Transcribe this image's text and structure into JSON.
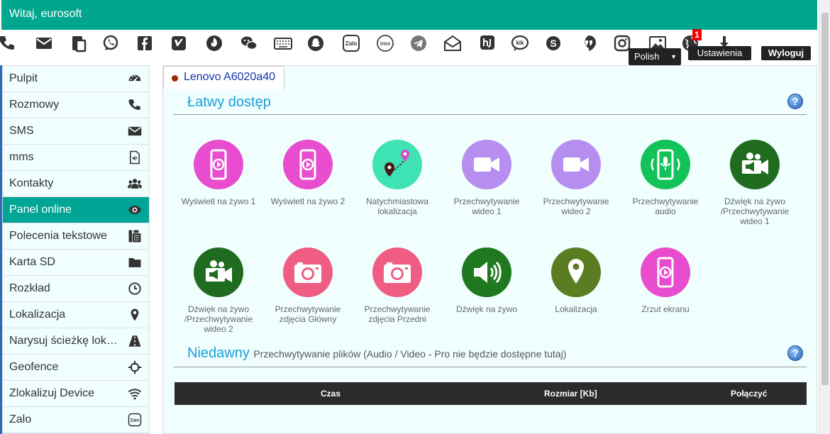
{
  "header": {
    "greeting": "Witaj, eurosoft"
  },
  "toolbar": {
    "icons": [
      "phone-icon",
      "mail-icon",
      "clipboard-icon",
      "whatsapp-icon",
      "facebook-icon",
      "viber-icon",
      "tinder-icon",
      "wechat-icon",
      "keyboard-icon",
      "snapchat-icon",
      "zalo-icon",
      "imo-icon",
      "telegram-icon",
      "email-open-icon",
      "hike-icon",
      "kik-icon",
      "skype-icon",
      "hangouts-icon",
      "instagram-icon",
      "photo-icon",
      "globe-icon",
      "download-icon"
    ],
    "badge": "1",
    "language": "Polish",
    "settings": "Ustawienia",
    "logout": "Wyloguj"
  },
  "sidebar": {
    "items": [
      {
        "label": "Pulpit",
        "icon": "dashboard-icon"
      },
      {
        "label": "Rozmowy",
        "icon": "phone-icon"
      },
      {
        "label": "SMS",
        "icon": "envelope-icon"
      },
      {
        "label": "mms",
        "icon": "audio-file-icon"
      },
      {
        "label": "Kontakty",
        "icon": "users-icon"
      },
      {
        "label": "Panel online",
        "icon": "eye-icon"
      },
      {
        "label": "Polecenia tekstowe",
        "icon": "fax-icon"
      },
      {
        "label": "Karta SD",
        "icon": "folder-icon"
      },
      {
        "label": "Rozkład",
        "icon": "clock-icon"
      },
      {
        "label": "Lokalizacja",
        "icon": "map-marker-icon"
      },
      {
        "label": "Narysuj ścieżkę lok…",
        "icon": "road-icon"
      },
      {
        "label": "Geofence",
        "icon": "crosshairs-icon"
      },
      {
        "label": "Zlokalizuj Device",
        "icon": "wifi-icon"
      },
      {
        "label": "Zalo",
        "icon": "zalo-icon"
      }
    ],
    "active_index": 5
  },
  "main": {
    "tab": "Lenovo A6020a40",
    "easy_access_title": "Łatwy dostęp",
    "recent_title": "Niedawny",
    "recent_sub": "Przechwytywanie plików (Audio / Video - Pro nie będzie dostępne tutaj)",
    "features": [
      {
        "label": "Wyświetl na żywo 1",
        "icon": "phone-play-icon",
        "color": "#e84ccf"
      },
      {
        "label": "Wyświetl na żywo 2",
        "icon": "phone-play-icon",
        "color": "#e84ccf"
      },
      {
        "label": "Natychmiastowa lokalizacja",
        "icon": "map-path-icon",
        "color": "#3fe3b3"
      },
      {
        "label": "Przechwytywanie wideo 1",
        "icon": "video-camera-icon",
        "color": "#b58ef0"
      },
      {
        "label": "Przechwytywanie wideo 2",
        "icon": "video-camera-icon",
        "color": "#b58ef0"
      },
      {
        "label": "Przechwytywanie audio",
        "icon": "phone-mic-icon",
        "color": "#14c25a"
      },
      {
        "label": "Dźwięk na żywo /Przechwytywanie wideo 1",
        "icon": "megaphone-camera-icon",
        "color": "#1f6b1f"
      },
      {
        "label": "Dźwięk na żywo /Przechwytywanie wideo 2",
        "icon": "megaphone-camera-icon",
        "color": "#1f6b1f"
      },
      {
        "label": "Przechwytywanie zdjęcia Główny",
        "icon": "camera-icon",
        "color": "#ef5d82"
      },
      {
        "label": "Przechwytywanie zdjęcia Przedni",
        "icon": "camera-icon",
        "color": "#ef5d82"
      },
      {
        "label": "Dźwięk na żywo",
        "icon": "speaker-icon",
        "color": "#1f7a1f"
      },
      {
        "label": "Lokalizacja",
        "icon": "map-pin-icon",
        "color": "#5a7d22"
      },
      {
        "label": "Zrzut ekranu",
        "icon": "phone-play-icon",
        "color": "#e84ccf"
      }
    ],
    "table_headers": [
      "Czas",
      "Rozmiar [Kb]",
      "Połączyć"
    ]
  }
}
